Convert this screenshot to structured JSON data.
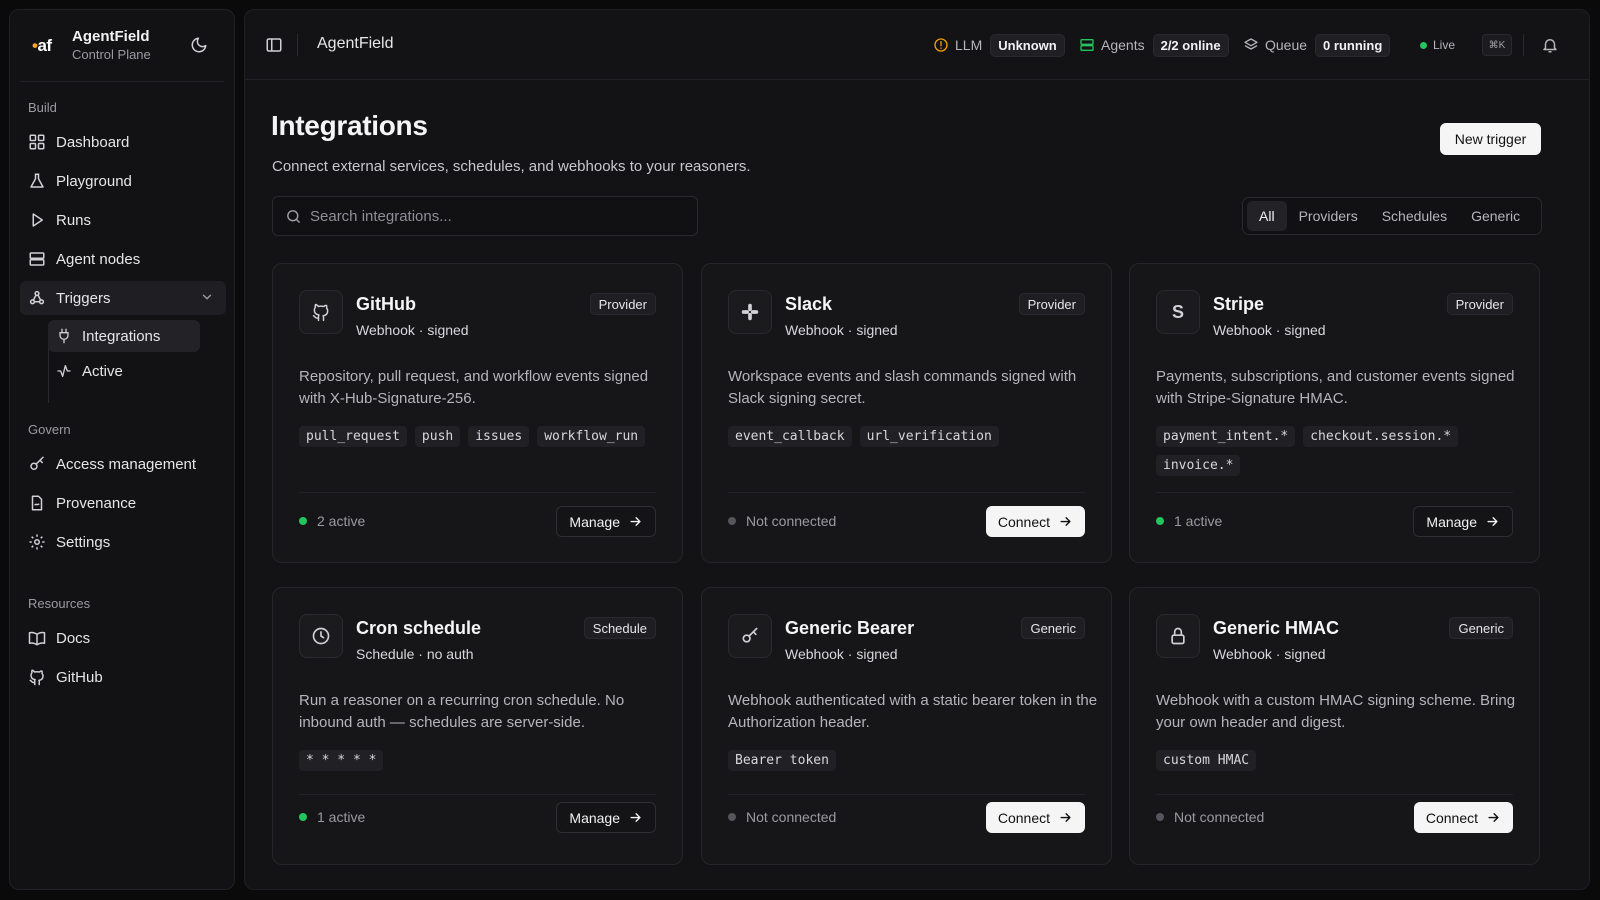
{
  "brand": {
    "logo": "af",
    "title": "AgentField",
    "subtitle": "Control Plane"
  },
  "sidebar": {
    "sections": {
      "build": "Build",
      "govern": "Govern",
      "resources": "Resources"
    },
    "build_items": [
      {
        "label": "Dashboard",
        "icon": "grid-icon"
      },
      {
        "label": "Playground",
        "icon": "flask-icon"
      },
      {
        "label": "Runs",
        "icon": "play-icon"
      },
      {
        "label": "Agent nodes",
        "icon": "server-icon"
      },
      {
        "label": "Triggers",
        "icon": "webhook-icon"
      }
    ],
    "triggers_sub": [
      {
        "label": "Integrations",
        "icon": "plug-icon"
      },
      {
        "label": "Active",
        "icon": "activity-icon"
      }
    ],
    "govern_items": [
      {
        "label": "Access management",
        "icon": "key-icon"
      },
      {
        "label": "Provenance",
        "icon": "file-signature-icon"
      },
      {
        "label": "Settings",
        "icon": "gear-icon"
      }
    ],
    "resource_items": [
      {
        "label": "Docs",
        "icon": "book-icon"
      },
      {
        "label": "GitHub",
        "icon": "github-icon"
      }
    ]
  },
  "topbar": {
    "title": "AgentField",
    "llm_label": "LLM",
    "llm_value": "Unknown",
    "agents_label": "Agents",
    "agents_value": "2/2 online",
    "queue_label": "Queue",
    "queue_value": "0 running",
    "live_label": "Live",
    "shortcut": "⌘K"
  },
  "page": {
    "title": "Integrations",
    "subtitle": "Connect external services, schedules, and webhooks to your reasoners.",
    "new_trigger": "New trigger",
    "search_placeholder": "Search integrations...",
    "filters": [
      "All",
      "Providers",
      "Schedules",
      "Generic"
    ]
  },
  "cards": [
    {
      "name": "GitHub",
      "meta": "Webhook · signed",
      "badge": "Provider",
      "icon": "github-icon",
      "desc": "Repository, pull request, and workflow events signed with X-Hub-Signature-256.",
      "tags": [
        "pull_request",
        "push",
        "issues",
        "workflow_run"
      ],
      "status": "2 active",
      "button": "Manage"
    },
    {
      "name": "Slack",
      "meta": "Webhook · signed",
      "badge": "Provider",
      "icon": "slack-icon",
      "desc": "Workspace events and slash commands signed with Slack signing secret.",
      "tags": [
        "event_callback",
        "url_verification"
      ],
      "status": "Not connected",
      "button": "Connect"
    },
    {
      "name": "Stripe",
      "meta": "Webhook · signed",
      "badge": "Provider",
      "icon": "stripe-icon",
      "desc": "Payments, subscriptions, and customer events signed with Stripe-Signature HMAC.",
      "tags": [
        "payment_intent.*",
        "checkout.session.*",
        "invoice.*"
      ],
      "status": "1 active",
      "button": "Manage"
    },
    {
      "name": "Cron schedule",
      "meta": "Schedule · no auth",
      "badge": "Schedule",
      "icon": "clock-icon",
      "desc": "Run a reasoner on a recurring cron schedule. No inbound auth — schedules are server-side.",
      "tags": [
        "* * * * *"
      ],
      "status": "1 active",
      "button": "Manage"
    },
    {
      "name": "Generic Bearer",
      "meta": "Webhook · signed",
      "badge": "Generic",
      "icon": "key-icon",
      "desc": "Webhook authenticated with a static bearer token in the Authorization header.",
      "tags": [
        "Bearer token"
      ],
      "status": "Not connected",
      "button": "Connect"
    },
    {
      "name": "Generic HMAC",
      "meta": "Webhook · signed",
      "badge": "Generic",
      "icon": "lock-icon",
      "desc": "Webhook with a custom HMAC signing scheme. Bring your own header and digest.",
      "tags": [
        "custom HMAC"
      ],
      "status": "Not connected",
      "button": "Connect"
    }
  ]
}
